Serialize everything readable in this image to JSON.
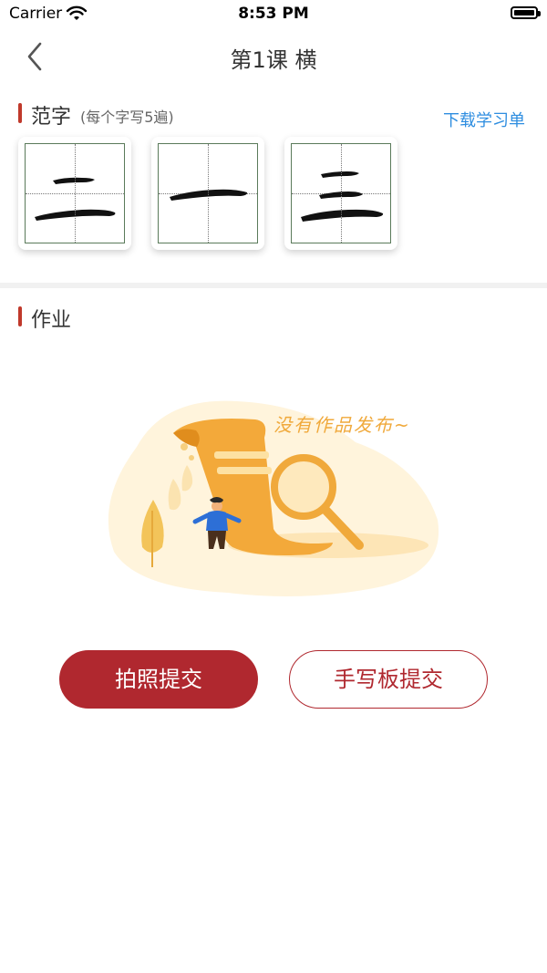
{
  "status_bar": {
    "carrier": "Carrier",
    "time": "8:53 PM"
  },
  "nav": {
    "title": "第1课 横",
    "back_icon": "chevron-left-icon"
  },
  "model_chars": {
    "title": "范字",
    "subtitle": "(每个字写5遍)",
    "download_label": "下载学习单",
    "cards": [
      "二",
      "一",
      "三"
    ]
  },
  "homework": {
    "title": "作业",
    "empty_text": "没有作品发布~",
    "illustration": "empty-search-illustration"
  },
  "actions": {
    "photo_submit": "拍照提交",
    "handwriting_submit": "手写板提交"
  },
  "colors": {
    "accent": "#b0282f",
    "link": "#2f8ee0",
    "illustration": "#f0a93b"
  }
}
